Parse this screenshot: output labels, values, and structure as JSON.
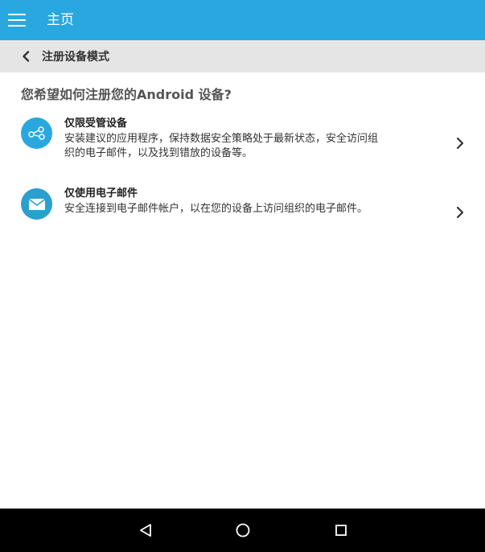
{
  "appbar": {
    "title": "主页",
    "menu_icon": "hamburger-menu-icon",
    "background_color": "#29a8e0"
  },
  "subbar": {
    "title": "注册设备模式",
    "back_icon": "chevron-left-icon"
  },
  "question": "您希望如何注册您的Android 设备?",
  "options": [
    {
      "title": "仅限受管设备",
      "description": "安装建议的应用程序，保持数据安全策略处于最新状态，安全访问组织的电子邮件，以及找到错放的设备等。",
      "icon": "share-nodes-icon",
      "arrow_icon": "chevron-right-icon"
    },
    {
      "title": "仅使用电子邮件",
      "description": "安全连接到电子邮件帐户，以在您的设备上访问组织的电子邮件。",
      "icon": "envelope-icon",
      "arrow_icon": "chevron-right-icon"
    }
  ],
  "navbar": {
    "back_icon": "nav-back-triangle-icon",
    "home_icon": "nav-home-circle-icon",
    "recent_icon": "nav-recent-square-icon"
  }
}
